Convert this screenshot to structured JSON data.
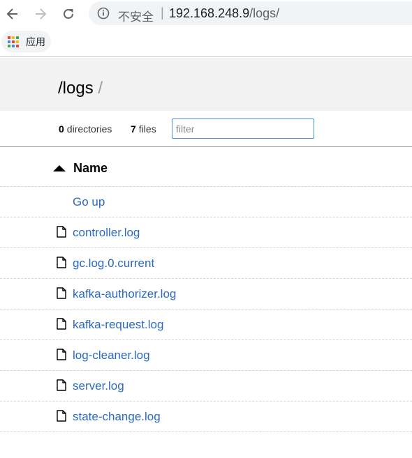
{
  "browser": {
    "security_label": "不安全",
    "url_host": "192.168.248.9",
    "url_path": "/logs/",
    "bookmarks": {
      "apps_label": "应用"
    },
    "apps_grid_colors": [
      "#ea4335",
      "#fbbc05",
      "#34a853",
      "#4285f4",
      "#ea4335",
      "#fbbc05",
      "#34a853",
      "#4285f4",
      "#ea4335"
    ]
  },
  "page": {
    "breadcrumb": {
      "sep": "/",
      "current": "logs",
      "trail": "/"
    },
    "summary": {
      "dirs_count": "0",
      "dirs_label": "directories",
      "files_count": "7",
      "files_label": "files"
    },
    "filter": {
      "value": "",
      "placeholder": "filter"
    },
    "listing": {
      "column_name": "Name",
      "sort_icon": "triangle-up-icon",
      "go_up": "Go up",
      "files": [
        "controller.log",
        "gc.log.0.current",
        "kafka-authorizer.log",
        "kafka-request.log",
        "log-cleaner.log",
        "server.log",
        "state-change.log"
      ]
    }
  }
}
